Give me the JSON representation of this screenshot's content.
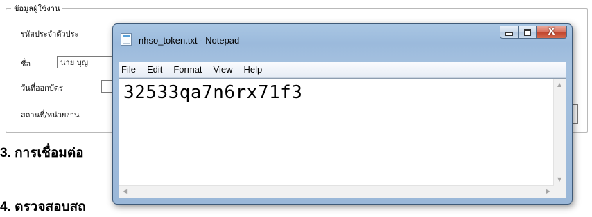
{
  "form": {
    "legend": "ข้อมูลผู้ใช้งาน",
    "id_label": "รหัสประจำตัวประ",
    "name_label": "ชื่อ",
    "name_value": "นาย บุญ",
    "issue_date_label": "วันที่ออกบัตร",
    "office_label": "สถานที่/หน่วยงาน"
  },
  "sections": {
    "step3": "3. การเชื่อมต่อ",
    "step4": "4. ตรวจสอบสถ"
  },
  "notepad": {
    "title": "nhso_token.txt - Notepad",
    "menu": [
      "File",
      "Edit",
      "Format",
      "View",
      "Help"
    ],
    "content": "32533qa7n6rx71f3",
    "close_symbol": "X"
  }
}
